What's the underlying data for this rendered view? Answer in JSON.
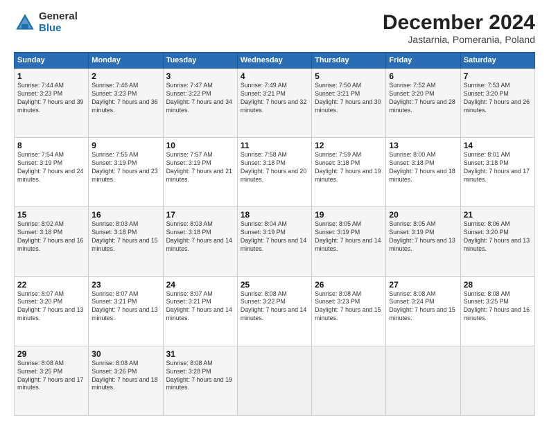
{
  "logo": {
    "general": "General",
    "blue": "Blue"
  },
  "header": {
    "month": "December 2024",
    "location": "Jastarnia, Pomerania, Poland"
  },
  "weekdays": [
    "Sunday",
    "Monday",
    "Tuesday",
    "Wednesday",
    "Thursday",
    "Friday",
    "Saturday"
  ],
  "weeks": [
    [
      {
        "day": "1",
        "sunrise": "7:44 AM",
        "sunset": "3:23 PM",
        "daylight": "7 hours and 39 minutes."
      },
      {
        "day": "2",
        "sunrise": "7:46 AM",
        "sunset": "3:23 PM",
        "daylight": "7 hours and 36 minutes."
      },
      {
        "day": "3",
        "sunrise": "7:47 AM",
        "sunset": "3:22 PM",
        "daylight": "7 hours and 34 minutes."
      },
      {
        "day": "4",
        "sunrise": "7:49 AM",
        "sunset": "3:21 PM",
        "daylight": "7 hours and 32 minutes."
      },
      {
        "day": "5",
        "sunrise": "7:50 AM",
        "sunset": "3:21 PM",
        "daylight": "7 hours and 30 minutes."
      },
      {
        "day": "6",
        "sunrise": "7:52 AM",
        "sunset": "3:20 PM",
        "daylight": "7 hours and 28 minutes."
      },
      {
        "day": "7",
        "sunrise": "7:53 AM",
        "sunset": "3:20 PM",
        "daylight": "7 hours and 26 minutes."
      }
    ],
    [
      {
        "day": "8",
        "sunrise": "7:54 AM",
        "sunset": "3:19 PM",
        "daylight": "7 hours and 24 minutes."
      },
      {
        "day": "9",
        "sunrise": "7:55 AM",
        "sunset": "3:19 PM",
        "daylight": "7 hours and 23 minutes."
      },
      {
        "day": "10",
        "sunrise": "7:57 AM",
        "sunset": "3:19 PM",
        "daylight": "7 hours and 21 minutes."
      },
      {
        "day": "11",
        "sunrise": "7:58 AM",
        "sunset": "3:18 PM",
        "daylight": "7 hours and 20 minutes."
      },
      {
        "day": "12",
        "sunrise": "7:59 AM",
        "sunset": "3:18 PM",
        "daylight": "7 hours and 19 minutes."
      },
      {
        "day": "13",
        "sunrise": "8:00 AM",
        "sunset": "3:18 PM",
        "daylight": "7 hours and 18 minutes."
      },
      {
        "day": "14",
        "sunrise": "8:01 AM",
        "sunset": "3:18 PM",
        "daylight": "7 hours and 17 minutes."
      }
    ],
    [
      {
        "day": "15",
        "sunrise": "8:02 AM",
        "sunset": "3:18 PM",
        "daylight": "7 hours and 16 minutes."
      },
      {
        "day": "16",
        "sunrise": "8:03 AM",
        "sunset": "3:18 PM",
        "daylight": "7 hours and 15 minutes."
      },
      {
        "day": "17",
        "sunrise": "8:03 AM",
        "sunset": "3:18 PM",
        "daylight": "7 hours and 14 minutes."
      },
      {
        "day": "18",
        "sunrise": "8:04 AM",
        "sunset": "3:19 PM",
        "daylight": "7 hours and 14 minutes."
      },
      {
        "day": "19",
        "sunrise": "8:05 AM",
        "sunset": "3:19 PM",
        "daylight": "7 hours and 14 minutes."
      },
      {
        "day": "20",
        "sunrise": "8:05 AM",
        "sunset": "3:19 PM",
        "daylight": "7 hours and 13 minutes."
      },
      {
        "day": "21",
        "sunrise": "8:06 AM",
        "sunset": "3:20 PM",
        "daylight": "7 hours and 13 minutes."
      }
    ],
    [
      {
        "day": "22",
        "sunrise": "8:07 AM",
        "sunset": "3:20 PM",
        "daylight": "7 hours and 13 minutes."
      },
      {
        "day": "23",
        "sunrise": "8:07 AM",
        "sunset": "3:21 PM",
        "daylight": "7 hours and 13 minutes."
      },
      {
        "day": "24",
        "sunrise": "8:07 AM",
        "sunset": "3:21 PM",
        "daylight": "7 hours and 14 minutes."
      },
      {
        "day": "25",
        "sunrise": "8:08 AM",
        "sunset": "3:22 PM",
        "daylight": "7 hours and 14 minutes."
      },
      {
        "day": "26",
        "sunrise": "8:08 AM",
        "sunset": "3:23 PM",
        "daylight": "7 hours and 15 minutes."
      },
      {
        "day": "27",
        "sunrise": "8:08 AM",
        "sunset": "3:24 PM",
        "daylight": "7 hours and 15 minutes."
      },
      {
        "day": "28",
        "sunrise": "8:08 AM",
        "sunset": "3:25 PM",
        "daylight": "7 hours and 16 minutes."
      }
    ],
    [
      {
        "day": "29",
        "sunrise": "8:08 AM",
        "sunset": "3:25 PM",
        "daylight": "7 hours and 17 minutes."
      },
      {
        "day": "30",
        "sunrise": "8:08 AM",
        "sunset": "3:26 PM",
        "daylight": "7 hours and 18 minutes."
      },
      {
        "day": "31",
        "sunrise": "8:08 AM",
        "sunset": "3:28 PM",
        "daylight": "7 hours and 19 minutes."
      },
      null,
      null,
      null,
      null
    ]
  ],
  "labels": {
    "sunrise": "Sunrise:",
    "sunset": "Sunset:",
    "daylight": "Daylight:"
  }
}
